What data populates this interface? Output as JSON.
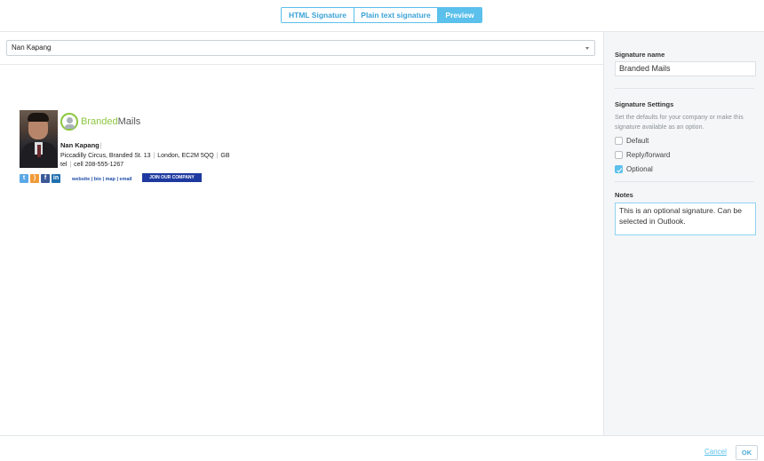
{
  "tabs": [
    {
      "label": "HTML Signature",
      "active": false
    },
    {
      "label": "Plain text signature",
      "active": false
    },
    {
      "label": "Preview",
      "active": true
    }
  ],
  "user_select": {
    "value": "Nan Kapang"
  },
  "signature": {
    "logo": {
      "part1": "Branded",
      "part2": "Mails"
    },
    "name": "Nan Kapang",
    "address": {
      "street": "Piccadilly Circus, Branded St. 13",
      "city": "London,  EC2M 5QQ",
      "country": "GB"
    },
    "phone": {
      "tel_label": "tel",
      "cell": "cell 208-555-1267"
    },
    "social_icons": [
      "twitter-icon",
      "rss-icon",
      "facebook-icon",
      "linkedin-icon"
    ],
    "links_text": "website | bio | map | email",
    "join_button": "JOIN OUR COMPANY"
  },
  "side": {
    "name_label": "Signature name",
    "name_value": "Branded Mails",
    "settings_label": "Signature Settings",
    "settings_desc": "Set the defaults for your company or make this signature available as an option.",
    "options": [
      {
        "label": "Default",
        "checked": false
      },
      {
        "label": "Reply/forward",
        "checked": false
      },
      {
        "label": "Optional",
        "checked": true
      }
    ],
    "notes_label": "Notes",
    "notes_value": "This is an optional signature. Can be selected in Outlook."
  },
  "footer": {
    "cancel": "Cancel",
    "ok": "OK"
  },
  "colors": {
    "accent": "#5bc0eb",
    "brand_green": "#8cc63f",
    "join_blue": "#1e3aa0"
  }
}
